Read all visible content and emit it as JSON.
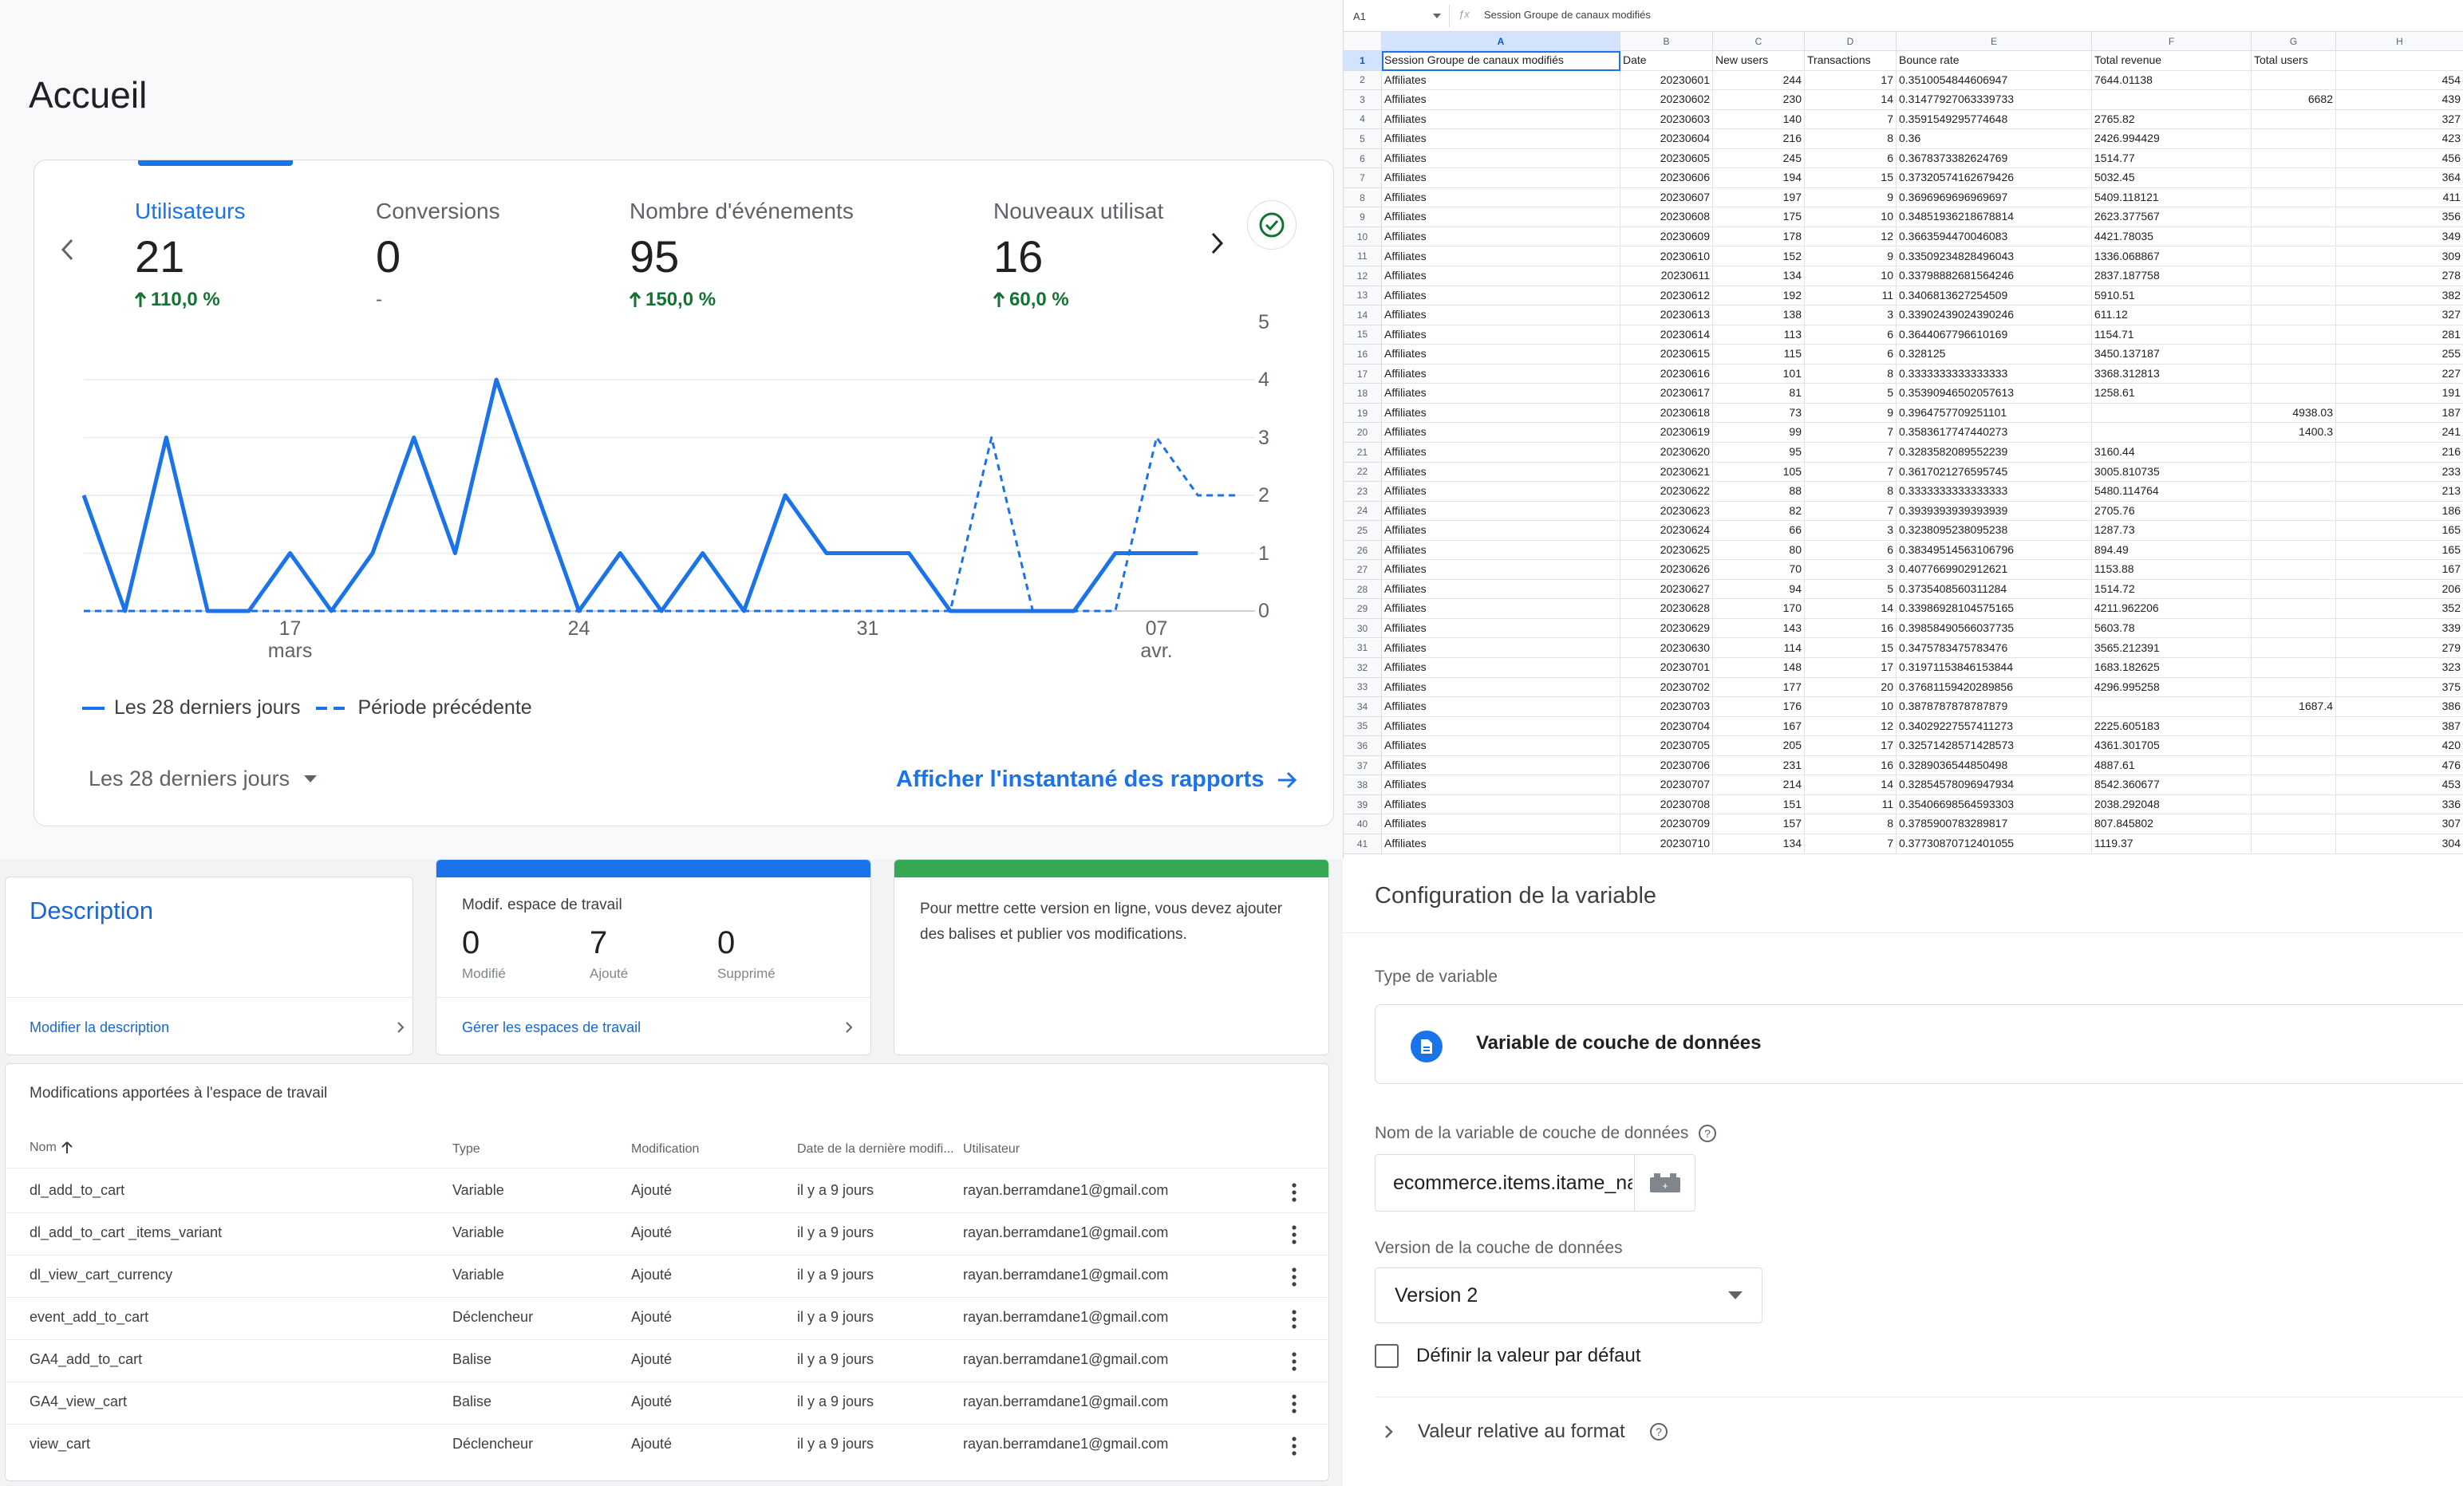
{
  "analytics": {
    "title": "Accueil",
    "metrics": [
      {
        "label": "Utilisateurs",
        "value": "21",
        "delta": "110,0 %"
      },
      {
        "label": "Conversions",
        "value": "0",
        "delta": "-"
      },
      {
        "label": "Nombre d'événements",
        "value": "95",
        "delta": "150,0 %"
      },
      {
        "label": "Nouveaux utilisat",
        "value": "16",
        "delta": "60,0 %"
      }
    ],
    "chart": {
      "type": "line",
      "y_ticks": [
        "5",
        "4",
        "3",
        "2",
        "1",
        "0"
      ],
      "x_ticks": [
        {
          "day": "17",
          "month": "mars"
        },
        {
          "day": "24",
          "month": ""
        },
        {
          "day": "31",
          "month": ""
        },
        {
          "day": "07",
          "month": "avr."
        }
      ],
      "current": [
        2,
        0,
        3,
        0,
        0,
        1,
        0,
        1,
        3,
        1,
        4,
        2,
        0,
        1,
        0,
        1,
        0,
        2,
        1,
        1,
        1,
        0,
        0,
        0,
        0,
        1,
        1,
        1
      ],
      "previous": [
        0,
        0,
        0,
        0,
        0,
        0,
        0,
        0,
        0,
        0,
        0,
        0,
        0,
        0,
        0,
        0,
        0,
        0,
        0,
        0,
        0,
        0,
        3,
        0,
        0,
        0,
        3,
        2,
        2
      ],
      "legend_current": "Les 28 derniers jours",
      "legend_previous": "Période précédente",
      "color": "#1a73e8"
    },
    "period": "Les 28 derniers jours",
    "snapshot_link": "Afficher l'instantané des rapports"
  },
  "sheet": {
    "cell_ref": "A1",
    "formula": "Session Groupe de canaux modifiés",
    "columns": [
      "A",
      "B",
      "C",
      "D",
      "E",
      "F",
      "G",
      "H"
    ],
    "headers": [
      "Session Groupe de canaux modifiés",
      "Date",
      "New users",
      "Transactions",
      "Bounce rate",
      "Total revenue",
      "Total users"
    ],
    "rows": [
      [
        "Affiliates",
        "20230601",
        "244",
        "17",
        "0.3510054844606947",
        "7644.01138",
        "",
        "454"
      ],
      [
        "Affiliates",
        "20230602",
        "230",
        "14",
        "0.31477927063339733",
        "",
        "6682",
        "439"
      ],
      [
        "Affiliates",
        "20230603",
        "140",
        "7",
        "0.3591549295774648",
        "2765.82",
        "",
        "327"
      ],
      [
        "Affiliates",
        "20230604",
        "216",
        "8",
        "0.36",
        "2426.994429",
        "",
        "423"
      ],
      [
        "Affiliates",
        "20230605",
        "245",
        "6",
        "0.3678373382624769",
        "1514.77",
        "",
        "456"
      ],
      [
        "Affiliates",
        "20230606",
        "194",
        "15",
        "0.37320574162679426",
        "5032.45",
        "",
        "364"
      ],
      [
        "Affiliates",
        "20230607",
        "197",
        "9",
        "0.3696969696969697",
        "5409.118121",
        "",
        "411"
      ],
      [
        "Affiliates",
        "20230608",
        "175",
        "10",
        "0.34851936218678814",
        "2623.377567",
        "",
        "356"
      ],
      [
        "Affiliates",
        "20230609",
        "178",
        "12",
        "0.3663594470046083",
        "4421.78035",
        "",
        "349"
      ],
      [
        "Affiliates",
        "20230610",
        "152",
        "9",
        "0.33509234828496043",
        "1336.068867",
        "",
        "309"
      ],
      [
        "Affiliates",
        "20230611",
        "134",
        "10",
        "0.33798882681564246",
        "2837.187758",
        "",
        "278"
      ],
      [
        "Affiliates",
        "20230612",
        "192",
        "11",
        "0.3406813627254509",
        "5910.51",
        "",
        "382"
      ],
      [
        "Affiliates",
        "20230613",
        "138",
        "3",
        "0.33902439024390246",
        "611.12",
        "",
        "327"
      ],
      [
        "Affiliates",
        "20230614",
        "113",
        "6",
        "0.3644067796610169",
        "1154.71",
        "",
        "281"
      ],
      [
        "Affiliates",
        "20230615",
        "115",
        "6",
        "0.328125",
        "3450.137187",
        "",
        "255"
      ],
      [
        "Affiliates",
        "20230616",
        "101",
        "8",
        "0.3333333333333333",
        "3368.312813",
        "",
        "227"
      ],
      [
        "Affiliates",
        "20230617",
        "81",
        "5",
        "0.35390946502057613",
        "1258.61",
        "",
        "191"
      ],
      [
        "Affiliates",
        "20230618",
        "73",
        "9",
        "0.3964757709251101",
        "",
        "4938.03",
        "187"
      ],
      [
        "Affiliates",
        "20230619",
        "99",
        "7",
        "0.3583617747440273",
        "",
        "1400.3",
        "241"
      ],
      [
        "Affiliates",
        "20230620",
        "95",
        "7",
        "0.3283582089552239",
        "3160.44",
        "",
        "216"
      ],
      [
        "Affiliates",
        "20230621",
        "105",
        "7",
        "0.3617021276595745",
        "3005.810735",
        "",
        "233"
      ],
      [
        "Affiliates",
        "20230622",
        "88",
        "8",
        "0.3333333333333333",
        "5480.114764",
        "",
        "213"
      ],
      [
        "Affiliates",
        "20230623",
        "82",
        "7",
        "0.3939393939393939",
        "2705.76",
        "",
        "186"
      ],
      [
        "Affiliates",
        "20230624",
        "66",
        "3",
        "0.3238095238095238",
        "1287.73",
        "",
        "165"
      ],
      [
        "Affiliates",
        "20230625",
        "80",
        "6",
        "0.38349514563106796",
        "894.49",
        "",
        "165"
      ],
      [
        "Affiliates",
        "20230626",
        "70",
        "3",
        "0.4077669902912621",
        "1153.88",
        "",
        "167"
      ],
      [
        "Affiliates",
        "20230627",
        "94",
        "5",
        "0.3735408560311284",
        "1514.72",
        "",
        "206"
      ],
      [
        "Affiliates",
        "20230628",
        "170",
        "14",
        "0.33986928104575165",
        "4211.962206",
        "",
        "352"
      ],
      [
        "Affiliates",
        "20230629",
        "143",
        "16",
        "0.39858490566037735",
        "5603.78",
        "",
        "339"
      ],
      [
        "Affiliates",
        "20230630",
        "114",
        "15",
        "0.3475783475783476",
        "3565.212391",
        "",
        "279"
      ],
      [
        "Affiliates",
        "20230701",
        "148",
        "17",
        "0.31971153846153844",
        "1683.182625",
        "",
        "323"
      ],
      [
        "Affiliates",
        "20230702",
        "177",
        "20",
        "0.37681159420289856",
        "4296.995258",
        "",
        "375"
      ],
      [
        "Affiliates",
        "20230703",
        "176",
        "10",
        "0.3878787878787879",
        "",
        "1687.4",
        "386"
      ],
      [
        "Affiliates",
        "20230704",
        "167",
        "12",
        "0.34029227557411273",
        "2225.605183",
        "",
        "387"
      ],
      [
        "Affiliates",
        "20230705",
        "205",
        "17",
        "0.32571428571428573",
        "4361.301705",
        "",
        "420"
      ],
      [
        "Affiliates",
        "20230706",
        "231",
        "16",
        "0.3289036544850498",
        "4887.61",
        "",
        "476"
      ],
      [
        "Affiliates",
        "20230707",
        "214",
        "14",
        "0.32854578096947934",
        "8542.360677",
        "",
        "453"
      ],
      [
        "Affiliates",
        "20230708",
        "151",
        "11",
        "0.35406698564593303",
        "2038.292048",
        "",
        "336"
      ],
      [
        "Affiliates",
        "20230709",
        "157",
        "8",
        "0.3785900783289817",
        "807.845802",
        "",
        "307"
      ],
      [
        "Affiliates",
        "20230710",
        "134",
        "7",
        "0.37730870712401055",
        "1119.37",
        "",
        "304"
      ]
    ]
  },
  "gtm": {
    "description": {
      "title": "Description",
      "link": "Modifier la description"
    },
    "workspace": {
      "title": "Modif. espace de travail",
      "stats": [
        {
          "value": "0",
          "label": "Modifié"
        },
        {
          "value": "7",
          "label": "Ajouté"
        },
        {
          "value": "0",
          "label": "Supprimé"
        }
      ],
      "link": "Gérer les espaces de travail",
      "bar_color": "#1a73e8"
    },
    "publish": {
      "text": "Pour mettre cette version en ligne, vous devez ajouter des balises et publier vos modifications.",
      "bar_color": "#34a853"
    },
    "changes": {
      "title": "Modifications apportées à l'espace de travail",
      "columns": [
        "Nom",
        "Type",
        "Modification",
        "Date de la dernière modifi...",
        "Utilisateur"
      ],
      "rows": [
        {
          "name": "dl_add_to_cart",
          "type": "Variable",
          "change": "Ajouté",
          "date": "il y a 9 jours",
          "user": "rayan.berramdane1@gmail.com"
        },
        {
          "name": "dl_add_to_cart _items_variant",
          "type": "Variable",
          "change": "Ajouté",
          "date": "il y a 9 jours",
          "user": "rayan.berramdane1@gmail.com"
        },
        {
          "name": "dl_view_cart_currency",
          "type": "Variable",
          "change": "Ajouté",
          "date": "il y a 9 jours",
          "user": "rayan.berramdane1@gmail.com"
        },
        {
          "name": "event_add_to_cart",
          "type": "Déclencheur",
          "change": "Ajouté",
          "date": "il y a 9 jours",
          "user": "rayan.berramdane1@gmail.com"
        },
        {
          "name": "GA4_add_to_cart",
          "type": "Balise",
          "change": "Ajouté",
          "date": "il y a 9 jours",
          "user": "rayan.berramdane1@gmail.com"
        },
        {
          "name": "GA4_view_cart",
          "type": "Balise",
          "change": "Ajouté",
          "date": "il y a 9 jours",
          "user": "rayan.berramdane1@gmail.com"
        },
        {
          "name": "view_cart",
          "type": "Déclencheur",
          "change": "Ajouté",
          "date": "il y a 9 jours",
          "user": "rayan.berramdane1@gmail.com"
        }
      ]
    }
  },
  "variable": {
    "title": "Configuration de la variable",
    "type_label": "Type de variable",
    "type_value": "Variable de couche de données",
    "name_label": "Nom de la variable de couche de données",
    "name_value": "ecommerce.items.itame_name",
    "version_label": "Version de la couche de données",
    "version_value": "Version 2",
    "default_label": "Définir la valeur par défaut",
    "format_label": "Valeur relative au format"
  }
}
